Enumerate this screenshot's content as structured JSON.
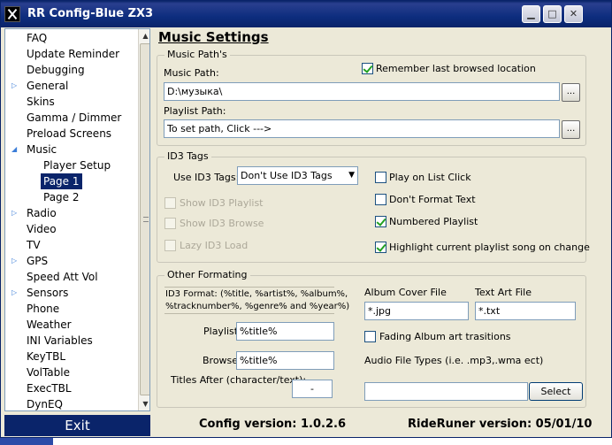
{
  "window": {
    "title": "RR Config-Blue ZX3"
  },
  "nav": {
    "items": [
      {
        "label": "FAQ",
        "indent": 0,
        "expandable": false,
        "selected": false
      },
      {
        "label": "Update Reminder",
        "indent": 0,
        "expandable": false,
        "selected": false
      },
      {
        "label": "Debugging",
        "indent": 0,
        "expandable": false,
        "selected": false
      },
      {
        "label": "General",
        "indent": 0,
        "expandable": true,
        "expanded": false,
        "selected": false
      },
      {
        "label": "Skins",
        "indent": 0,
        "expandable": false,
        "selected": false
      },
      {
        "label": "Gamma / Dimmer",
        "indent": 0,
        "expandable": false,
        "selected": false
      },
      {
        "label": "Preload Screens",
        "indent": 0,
        "expandable": false,
        "selected": false
      },
      {
        "label": "Music",
        "indent": 0,
        "expandable": true,
        "expanded": true,
        "selected": false
      },
      {
        "label": "Player Setup",
        "indent": 1,
        "expandable": false,
        "selected": false
      },
      {
        "label": "Page 1",
        "indent": 1,
        "expandable": false,
        "selected": true
      },
      {
        "label": "Page 2",
        "indent": 1,
        "expandable": false,
        "selected": false
      },
      {
        "label": "Radio",
        "indent": 0,
        "expandable": true,
        "expanded": false,
        "selected": false
      },
      {
        "label": "Video",
        "indent": 0,
        "expandable": false,
        "selected": false
      },
      {
        "label": "TV",
        "indent": 0,
        "expandable": false,
        "selected": false
      },
      {
        "label": "GPS",
        "indent": 0,
        "expandable": true,
        "expanded": false,
        "selected": false
      },
      {
        "label": "Speed Att Vol",
        "indent": 0,
        "expandable": false,
        "selected": false
      },
      {
        "label": "Sensors",
        "indent": 0,
        "expandable": true,
        "expanded": false,
        "selected": false
      },
      {
        "label": "Phone",
        "indent": 0,
        "expandable": false,
        "selected": false
      },
      {
        "label": "Weather",
        "indent": 0,
        "expandable": false,
        "selected": false
      },
      {
        "label": "INI Variables",
        "indent": 0,
        "expandable": false,
        "selected": false
      },
      {
        "label": "KeyTBL",
        "indent": 0,
        "expandable": false,
        "selected": false
      },
      {
        "label": "VolTable",
        "indent": 0,
        "expandable": false,
        "selected": false
      },
      {
        "label": "ExecTBL",
        "indent": 0,
        "expandable": false,
        "selected": false
      },
      {
        "label": "DynEQ",
        "indent": 0,
        "expandable": false,
        "selected": false
      }
    ]
  },
  "main": {
    "title": "Music Settings",
    "paths": {
      "group_label": "Music Path's",
      "music_path_label": "Music Path:",
      "music_path_value": "D:\\музыка\\",
      "remember_label": "Remember last browsed location",
      "remember_checked": true,
      "playlist_path_label": "Playlist Path:",
      "playlist_path_value": "To set path, Click --->",
      "browse_button": "..."
    },
    "id3": {
      "group_label": "ID3 Tags",
      "use_label": "Use ID3 Tags:",
      "use_value": "Don't Use ID3 Tags",
      "show_playlist": "Show ID3 Playlist",
      "show_browse": "Show ID3 Browse",
      "lazy_load": "Lazy ID3 Load",
      "play_on_click": "Play on List Click",
      "play_on_click_checked": false,
      "dont_format": "Don't Format Text",
      "dont_format_checked": false,
      "numbered": "Numbered Playlist",
      "numbered_checked": true,
      "highlight": "Highlight current playlist song on change",
      "highlight_checked": true
    },
    "formatting": {
      "group_label": "Other Formating",
      "format_help_line1": "ID3 Format: (%title, %artist%, %album%,",
      "format_help_line2": "%tracknumber%, %genre% and %year%)",
      "playlist_label": "Playlist:",
      "playlist_value": "%title%",
      "browse_label": "Browse:",
      "browse_value": "%title%",
      "titles_after_label": "Titles After (character/text):",
      "titles_after_value": "-",
      "album_cover_label": "Album Cover File",
      "album_cover_value": "*.jpg",
      "text_art_label": "Text Art File",
      "text_art_value": "*.txt",
      "fading_label": "Fading Album art trasitions",
      "fading_checked": false,
      "audio_types_label": "Audio File Types (i.e. .mp3,.wma ect)",
      "audio_types_value": "",
      "select_button": "Select"
    }
  },
  "footer": {
    "exit": "Exit",
    "config_version": "Config version: 1.0.2.6",
    "rideruner_version": "RideRuner version: 05/01/10"
  }
}
